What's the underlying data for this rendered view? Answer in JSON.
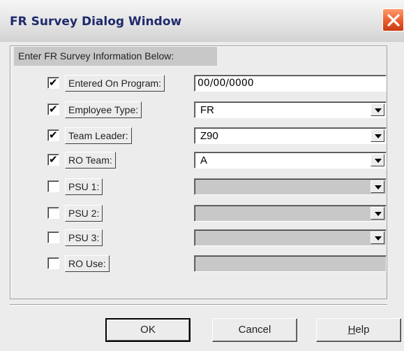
{
  "window": {
    "title": "FR Survey Dialog Window"
  },
  "group": {
    "label": "Enter FR Survey Information Below:"
  },
  "rows": [
    {
      "label": "Entered On Program:",
      "checked": true,
      "type": "text",
      "value": "00/00/0000",
      "enabled": true
    },
    {
      "label": "Employee Type:",
      "checked": true,
      "type": "select",
      "value": "FR",
      "enabled": true
    },
    {
      "label": "Team Leader:",
      "checked": true,
      "type": "select",
      "value": "Z90",
      "enabled": true
    },
    {
      "label": "RO Team:",
      "checked": true,
      "type": "select",
      "value": "A",
      "enabled": true
    },
    {
      "label": "PSU 1:",
      "checked": false,
      "type": "select",
      "value": "",
      "enabled": false
    },
    {
      "label": "PSU 2:",
      "checked": false,
      "type": "select",
      "value": "",
      "enabled": false
    },
    {
      "label": "PSU 3:",
      "checked": false,
      "type": "select",
      "value": "",
      "enabled": false
    },
    {
      "label": "RO Use:",
      "checked": false,
      "type": "text",
      "value": "",
      "enabled": false
    }
  ],
  "buttons": {
    "ok": "OK",
    "cancel": "Cancel",
    "help_mnemonic": "H",
    "help_rest": "elp"
  },
  "colors": {
    "title_text": "#1f2a6b",
    "close_button": "#e7582a",
    "dialog_bg": "#ececec",
    "disabled_field": "#c8c8c8"
  },
  "icons": {
    "close": "close-icon",
    "dropdown": "chevron-down-icon",
    "check": "checkmark-icon"
  }
}
